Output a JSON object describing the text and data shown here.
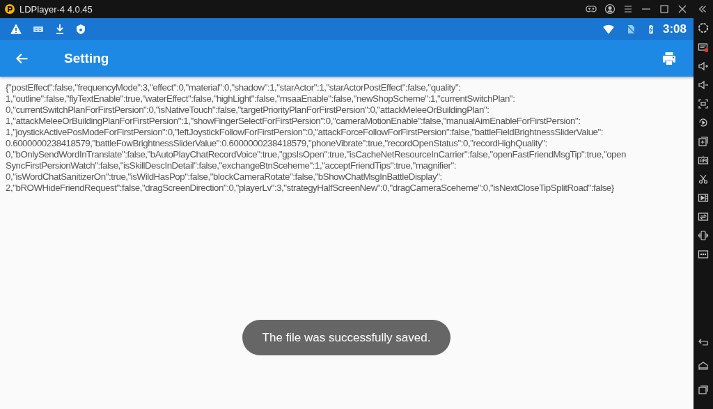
{
  "window": {
    "title": "LDPlayer-4 4.0.45"
  },
  "status_bar": {
    "time": "3:08"
  },
  "app_bar": {
    "title": "Setting"
  },
  "content": {
    "lines": [
      "{\"postEffect\":false,\"frequencyMode\":3,\"effect\":0,\"material\":0,\"shadow\":1,\"starActor\":1,\"starActorPostEffect\":false,\"quality\":",
      "1,\"outline\":false,\"flyTextEnable\":true,\"waterEffect\":false,\"highLight\":false,\"msaaEnable\":false,\"newShopScheme\":1,\"currentSwitchPlan\":",
      "0,\"currentSwitchPlanForFirstPersion\":0,\"isNativeTouch\":false,\"targetPriorityPlanForFirstPersion\":0,\"attackMeleeOrBuildingPlan\":",
      "1,\"attackMeleeOrBuildingPlanForFirstPersion\":1,\"showFingerSelectForFirstPersion\":0,\"cameraMotionEnable\":false,\"manualAimEnableForFirstPersion\":",
      "1,\"joystickActivePosModeForFirstPersion\":0,\"leftJoystickFollowForFirstPersion\":0,\"attackForceFollowForFirstPersion\":false,\"battleFieldBrightnessSliderValue\":",
      "0.6000000238418579,\"battleFowBrightnessSliderValue\":0.6000000238418579,\"phoneVibrate\":true,\"recordOpenStatus\":0,\"recordHighQuality\":",
      "0,\"bOnlySendWordInTranslate\":false,\"bAutoPlayChatRecordVoice\":true,\"gpsIsOpen\":true,\"isCacheNetResourceInCarrier\":false,\"openFastFriendMsgTip\":true,\"open",
      "SyncFirstPersionWatch\":false,\"isSkillDescInDetail\":false,\"exchangeBtnSceheme\":1,\"acceptFriendTips\":true,\"magnifier\":",
      "0,\"isWordChatSanitizerOn\":true,\"isWildHasPop\":false,\"blockCameraRotate\":false,\"bShowChatMsgInBattleDisplay\":",
      "2,\"bROWHideFriendRequest\":false,\"dragScreenDirection\":0,\"playerLv\":3,\"strategyHalfScreenNew\":0,\"dragCameraSceheme\":0,\"isNextCloseTipSplitRoad\":false}"
    ]
  },
  "toast": {
    "message": "The file was successfully saved."
  }
}
